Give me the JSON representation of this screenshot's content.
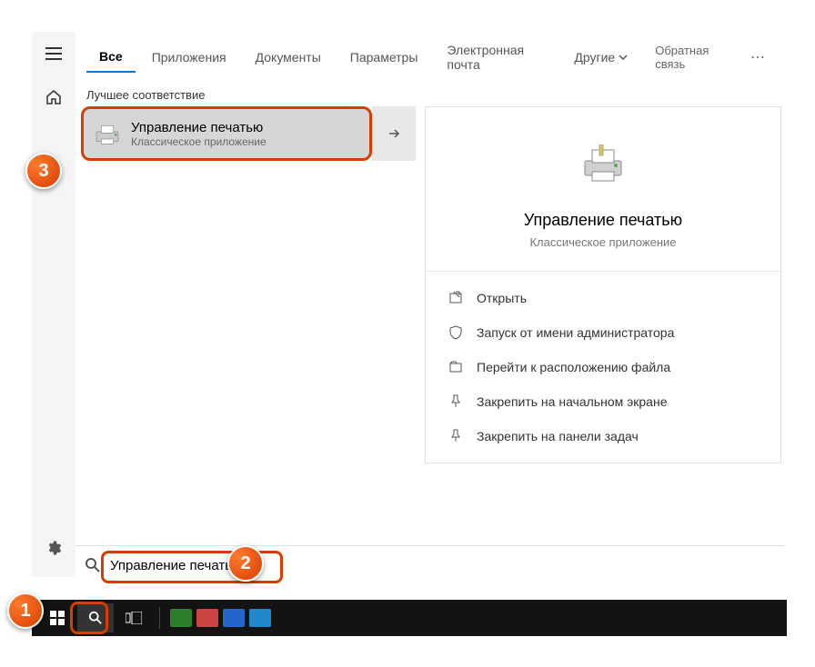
{
  "tabs": {
    "all": "Все",
    "apps": "Приложения",
    "docs": "Документы",
    "settings": "Параметры",
    "email": "Электронная почта",
    "other": "Другие"
  },
  "feedback": "Обратная связь",
  "section_label": "Лучшее соответствие",
  "best_match": {
    "title": "Управление печатью",
    "subtitle": "Классическое приложение"
  },
  "preview": {
    "title": "Управление печатью",
    "subtitle": "Классическое приложение",
    "actions": {
      "open": "Открыть",
      "admin": "Запуск от имени администратора",
      "location": "Перейти к расположению файла",
      "pin_start": "Закрепить на начальном экране",
      "pin_taskbar": "Закрепить на панели задач"
    }
  },
  "search": {
    "value": "Управление печатью"
  },
  "steps": {
    "s1": "1",
    "s2": "2",
    "s3": "3"
  }
}
